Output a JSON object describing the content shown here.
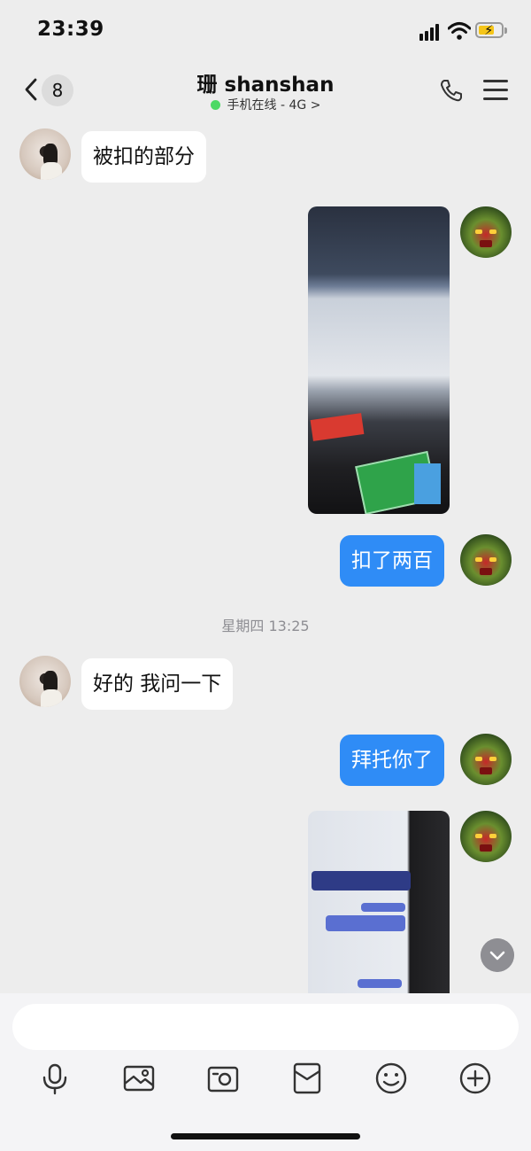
{
  "status": {
    "time": "23:39"
  },
  "header": {
    "unread_count": "8",
    "contact_name": "珊 shanshan",
    "presence": "手机在线 - 4G >"
  },
  "messages": [
    {
      "side": "incoming",
      "type": "text",
      "text": "被扣的部分"
    },
    {
      "side": "outgoing",
      "type": "image"
    },
    {
      "side": "outgoing",
      "type": "text",
      "text": "扣了两百"
    },
    {
      "side": "incoming",
      "type": "text",
      "text": "好的 我问一下"
    },
    {
      "side": "outgoing",
      "type": "text",
      "text": "拜托你了"
    },
    {
      "side": "outgoing",
      "type": "image"
    }
  ],
  "timestamp": "星期四 13:25",
  "composer": {
    "placeholder": ""
  },
  "toolbar": {
    "icons": [
      "microphone-icon",
      "gallery-icon",
      "camera-icon",
      "red-packet-icon",
      "emoji-icon",
      "plus-icon"
    ]
  },
  "colors": {
    "outgoing_bubble": "#2f8cf6",
    "incoming_bubble": "#ffffff",
    "background": "#ededed",
    "online_dot": "#4cd964"
  }
}
